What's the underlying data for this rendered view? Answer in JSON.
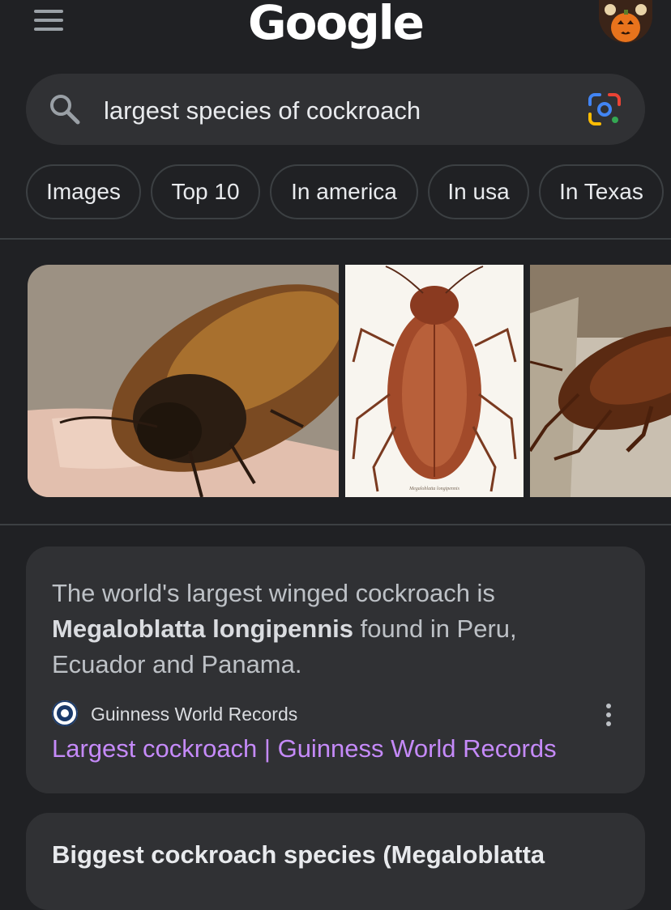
{
  "header": {
    "logo": "Google"
  },
  "search": {
    "query": "largest species of cockroach"
  },
  "chips": [
    {
      "label": "Images"
    },
    {
      "label": "Top 10"
    },
    {
      "label": "In america"
    },
    {
      "label": "In usa"
    },
    {
      "label": "In Texas"
    }
  ],
  "images": [
    {
      "alt": "Madagascar hissing cockroach on a hand"
    },
    {
      "alt": "Megaloblatta longipennis illustration",
      "caption": "Megaloblatta longipennis"
    },
    {
      "alt": "Cockroach on wood"
    }
  ],
  "featured": {
    "text_before": "The world's largest winged cockroach is ",
    "bold": "Megaloblatta longipennis",
    "text_after": " found in Peru, Ecuador and Panama.",
    "source_name": "Guinness World Records",
    "link_text": "Largest cockroach | Guinness World Records"
  },
  "next_card": {
    "text": "Biggest cockroach species (Megaloblatta"
  },
  "colors": {
    "background": "#202124",
    "card": "#303134",
    "link": "#c58af9"
  },
  "icons": [
    "menu-icon",
    "search-icon",
    "google-lens-icon",
    "more-vert-icon",
    "guinness-favicon"
  ]
}
